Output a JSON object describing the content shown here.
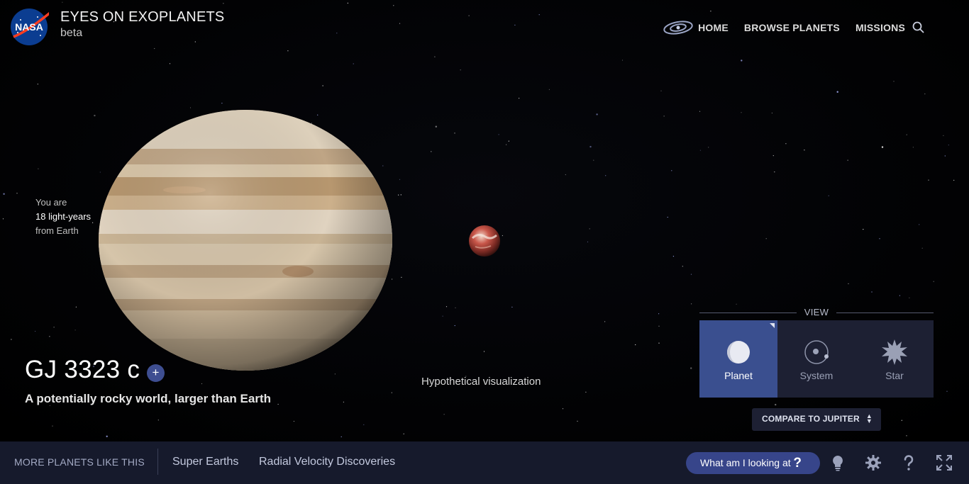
{
  "app": {
    "title": "EYES ON EXOPLANETS",
    "subtitle": "beta",
    "logo_text": "NASA"
  },
  "nav": {
    "items": [
      "HOME",
      "BROWSE PLANETS",
      "MISSIONS"
    ],
    "icons": {
      "home": "galaxy-icon",
      "search": "search-icon"
    }
  },
  "distance": {
    "line1": "You are",
    "line2": "18 light-years",
    "line3": "from Earth"
  },
  "planet": {
    "name": "GJ 3323 c",
    "add_label": "+",
    "tagline": "A potentially rocky world, larger than Earth",
    "visualization_note": "Hypothetical visualization"
  },
  "view": {
    "label": "VIEW",
    "options": [
      {
        "label": "Planet",
        "icon": "planet-icon",
        "active": true
      },
      {
        "label": "System",
        "icon": "system-icon",
        "active": false
      },
      {
        "label": "Star",
        "icon": "star-icon",
        "active": false
      }
    ]
  },
  "compare": {
    "label": "COMPARE TO JUPITER",
    "arrows": "▲▼"
  },
  "bottom": {
    "more_label": "MORE PLANETS LIKE THIS",
    "links": [
      "Super Earths",
      "Radial Velocity Discoveries"
    ],
    "what_label": "What am I looking at",
    "what_icon": "?",
    "tools": [
      "lightbulb-icon",
      "gear-icon",
      "help-icon",
      "fullscreen-icon"
    ]
  },
  "colors": {
    "accent": "#3a4f8f",
    "panel": "#1d2033",
    "bar": "#161a2c"
  }
}
